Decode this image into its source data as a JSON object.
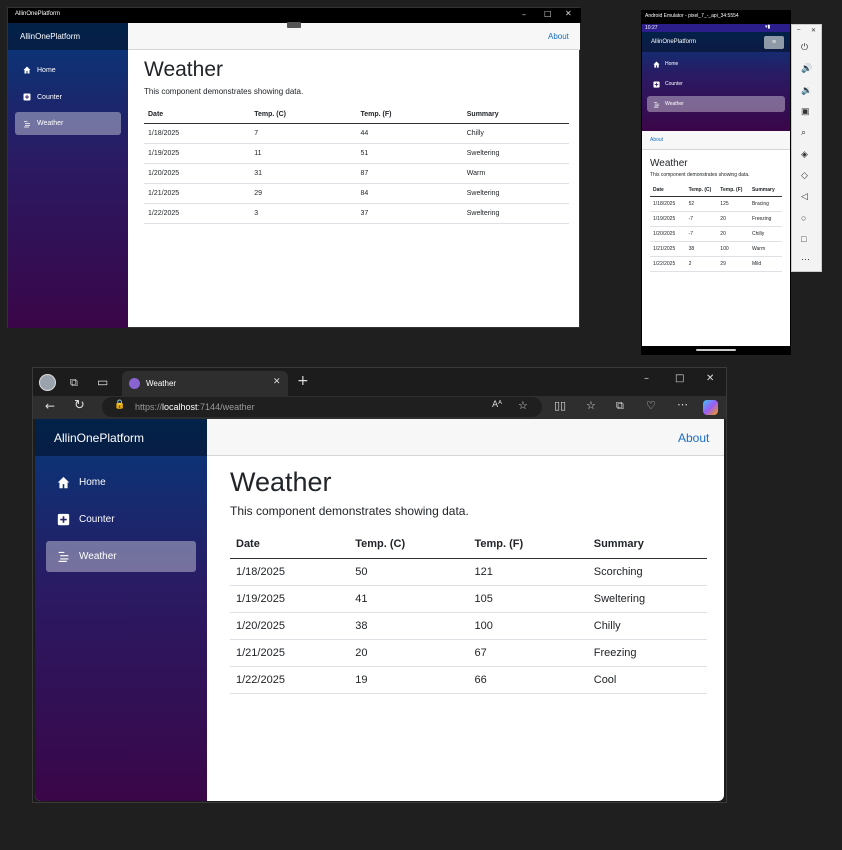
{
  "app_name": "AllinOnePlatform",
  "nav": {
    "home": "Home",
    "counter": "Counter",
    "weather": "Weather"
  },
  "about": "About",
  "page_title": "Weather",
  "page_desc": "This component demonstrates showing data.",
  "columns": [
    "Date",
    "Temp. (C)",
    "Temp. (F)",
    "Summary"
  ],
  "win_desktop": {
    "title": "AllinOnePlatform",
    "rows": [
      [
        "1/18/2025",
        "7",
        "44",
        "Chilly"
      ],
      [
        "1/19/2025",
        "11",
        "51",
        "Sweltering"
      ],
      [
        "1/20/2025",
        "31",
        "87",
        "Warm"
      ],
      [
        "1/21/2025",
        "29",
        "84",
        "Sweltering"
      ],
      [
        "1/22/2025",
        "3",
        "37",
        "Sweltering"
      ]
    ]
  },
  "emulator": {
    "title": "Android Emulator - pixel_7_-_api_34:5554",
    "status_time": "10:27",
    "rows": [
      [
        "1/18/2025",
        "52",
        "125",
        "Bracing"
      ],
      [
        "1/19/2025",
        "-7",
        "20",
        "Freezing"
      ],
      [
        "1/20/2025",
        "-7",
        "20",
        "Chilly"
      ],
      [
        "1/21/2025",
        "38",
        "100",
        "Warm"
      ],
      [
        "1/22/2025",
        "2",
        "29",
        "Mild"
      ]
    ]
  },
  "browser": {
    "tab_title": "Weather",
    "url_scheme": "https://",
    "url_host": "localhost",
    "url_rest": ":7144/weather",
    "rows": [
      [
        "1/18/2025",
        "50",
        "121",
        "Scorching"
      ],
      [
        "1/19/2025",
        "41",
        "105",
        "Sweltering"
      ],
      [
        "1/20/2025",
        "38",
        "100",
        "Chilly"
      ],
      [
        "1/21/2025",
        "20",
        "67",
        "Freezing"
      ],
      [
        "1/22/2025",
        "19",
        "66",
        "Cool"
      ]
    ]
  },
  "colors": {
    "nav_top": "#05397a",
    "nav_bottom": "#3a0648",
    "link": "#1b6ec2"
  }
}
